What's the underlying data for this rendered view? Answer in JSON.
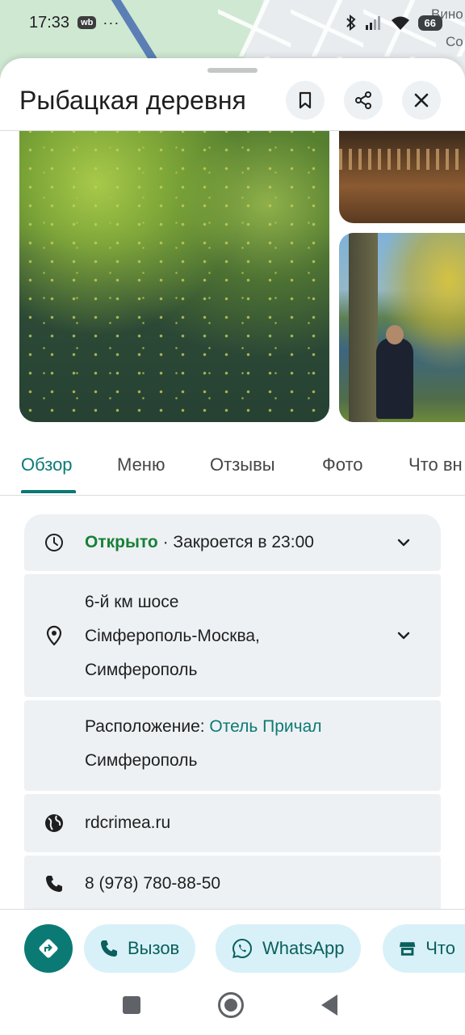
{
  "status_bar": {
    "time": "17:33",
    "app_badge": "wb",
    "more": "···",
    "battery": "66"
  },
  "map": {
    "labels": [
      "Вино",
      "Со"
    ]
  },
  "place": {
    "title": "Рыбацкая деревня"
  },
  "tabs": [
    {
      "label": "Обзор",
      "active": true
    },
    {
      "label": "Меню",
      "active": false
    },
    {
      "label": "Отзывы",
      "active": false
    },
    {
      "label": "Фото",
      "active": false
    },
    {
      "label": "Что вн",
      "active": false
    }
  ],
  "info": {
    "hours": {
      "status": "Открыто",
      "separator": " · ",
      "closes": "Закроется в 23:00"
    },
    "address": {
      "line1": "6-й км шосе",
      "line2": "Сімферополь-Москва,",
      "line3": "Симферополь"
    },
    "location": {
      "prefix": "Расположение: ",
      "link_part1": "Отель Причал",
      "link_part2": "Симферополь"
    },
    "website": "rdcrimea.ru",
    "phone": "8 (978) 780-88-50"
  },
  "actions": {
    "call_label": "Вызов",
    "whatsapp_label": "WhatsApp",
    "more_label": "Что"
  },
  "colors": {
    "accent": "#0b7a75",
    "open_green": "#188038",
    "chip_bg": "#d8f1f8",
    "card_bg": "#eef1f4"
  },
  "icons": {
    "header": [
      "bookmark-icon",
      "share-icon",
      "close-icon"
    ],
    "info": [
      "clock-icon",
      "location-pin-icon",
      "globe-icon",
      "phone-icon"
    ],
    "actions": [
      "directions-icon",
      "phone-icon",
      "whatsapp-icon",
      "store-icon"
    ]
  }
}
